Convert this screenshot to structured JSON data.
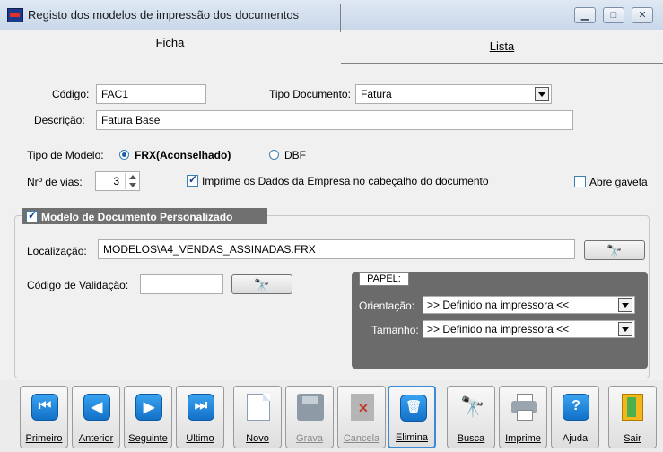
{
  "window": {
    "title": "Registo dos modelos de impressão dos documentos"
  },
  "tabs": [
    {
      "label": "Ficha",
      "accesskey": "F"
    },
    {
      "label": "Lista",
      "accesskey": "L"
    }
  ],
  "form": {
    "codigo_label": "Código:",
    "codigo_value": "FAC1",
    "tipo_doc_label": "Tipo Documento:",
    "tipo_doc_value": "Fatura",
    "descricao_label": "Descrição:",
    "descricao_value": "Fatura Base",
    "tipo_modelo_label": "Tipo de Modelo:",
    "radio_frx_label": "FRX(Aconselhado)",
    "radio_dbf_label": "DBF",
    "selected_modelo": "FRX(Aconselhado)",
    "vias_label": "Nrº de vias:",
    "vias_value": "3",
    "imprime_dados_label": "Imprime os Dados da Empresa no cabeçalho do documento",
    "imprime_dados_checked": true,
    "abre_gaveta_label": "Abre gaveta",
    "abre_gaveta_checked": false
  },
  "group": {
    "title": "Modelo de Documento Personalizado",
    "checked": true,
    "localizacao_label": "Localização:",
    "localizacao_value": "MODELOS\\A4_VENDAS_ASSINADAS.FRX",
    "validacao_label": "Código de Validação:",
    "validacao_value": ""
  },
  "papel": {
    "title": "PAPEL:",
    "orientacao_label": "Orientação:",
    "orientacao_value": ">> Definido na impressora <<",
    "tamanho_label": "Tamanho:",
    "tamanho_value": ">> Definido na impressora <<"
  },
  "toolbar": [
    {
      "label": "Primeiro",
      "icon": "first-icon",
      "enabled": true
    },
    {
      "label": "Anterior",
      "icon": "previous-icon",
      "enabled": true
    },
    {
      "label": "Seguinte",
      "icon": "next-icon",
      "enabled": true
    },
    {
      "label": "Ultimo",
      "icon": "last-icon",
      "enabled": true
    },
    {
      "label": "Novo",
      "icon": "new-document-icon",
      "enabled": true
    },
    {
      "label": "Grava",
      "icon": "save-disk-icon",
      "enabled": false
    },
    {
      "label": "Cancela",
      "icon": "cancel-document-icon",
      "enabled": false
    },
    {
      "label": "Elimina",
      "icon": "trash-icon",
      "enabled": true,
      "focused": true
    },
    {
      "label": "Busca",
      "icon": "binoculars-icon",
      "enabled": true
    },
    {
      "label": "Imprime",
      "icon": "printer-icon",
      "enabled": true
    },
    {
      "label": "Ajuda",
      "icon": "help-icon",
      "enabled": true
    },
    {
      "label": "Sair",
      "icon": "exit-door-icon",
      "enabled": true
    }
  ],
  "colors": {
    "nav_blue": "#1a7fd8",
    "papel_panel": "#6b6b6b",
    "focus_border": "#3a8ad6"
  }
}
